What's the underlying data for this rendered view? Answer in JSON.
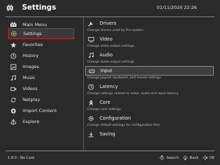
{
  "header": {
    "title": "Settings",
    "clock": "01/11/2020 22:26"
  },
  "sidebar": {
    "items": [
      {
        "label": "Main Menu",
        "icon": "main-menu-icon"
      },
      {
        "label": "Settings",
        "icon": "gear-icon",
        "selected": true
      },
      {
        "label": "Favorites",
        "icon": "star-icon"
      },
      {
        "label": "History",
        "icon": "history-icon"
      },
      {
        "label": "Images",
        "icon": "image-icon"
      },
      {
        "label": "Music",
        "icon": "music-icon"
      },
      {
        "label": "Videos",
        "icon": "video-icon"
      },
      {
        "label": "Netplay",
        "icon": "netplay-icon"
      },
      {
        "label": "Import Content",
        "icon": "plus-icon"
      },
      {
        "label": "Explore",
        "icon": "explore-icon"
      }
    ]
  },
  "settings": {
    "items": [
      {
        "label": "Drivers",
        "desc": "Change drivers used by the system.",
        "icon": "drivers-icon"
      },
      {
        "label": "Video",
        "desc": "Change video output settings.",
        "icon": "video-output-icon"
      },
      {
        "label": "Audio",
        "desc": "Change audio output settings.",
        "icon": "audio-icon"
      },
      {
        "label": "Input",
        "desc": "Change joypad, keyboard, and mouse settings.",
        "icon": "input-icon",
        "selected": true
      },
      {
        "label": "Latency",
        "desc": "Change settings related to video, audio and input latency.",
        "icon": "latency-icon"
      },
      {
        "label": "Core",
        "desc": "Change core settings.",
        "icon": "core-icon"
      },
      {
        "label": "Configuration",
        "desc": "Change default settings for configuration files.",
        "icon": "configuration-icon"
      },
      {
        "label": "Saving",
        "desc": "",
        "icon": "saving-icon"
      }
    ]
  },
  "footer": {
    "core_label": "1.8.0 - No Core",
    "hints": [
      {
        "label": "Search",
        "icon": "search-button-icon"
      },
      {
        "label": "Back",
        "icon": "back-button-icon"
      },
      {
        "label": "OK",
        "icon": "ok-button-icon"
      }
    ]
  },
  "colors": {
    "background": "#2a2a2a",
    "selection_border": "#c0272d",
    "selected_icon": "#9ccc3a",
    "rule": "#8a8a8a"
  }
}
